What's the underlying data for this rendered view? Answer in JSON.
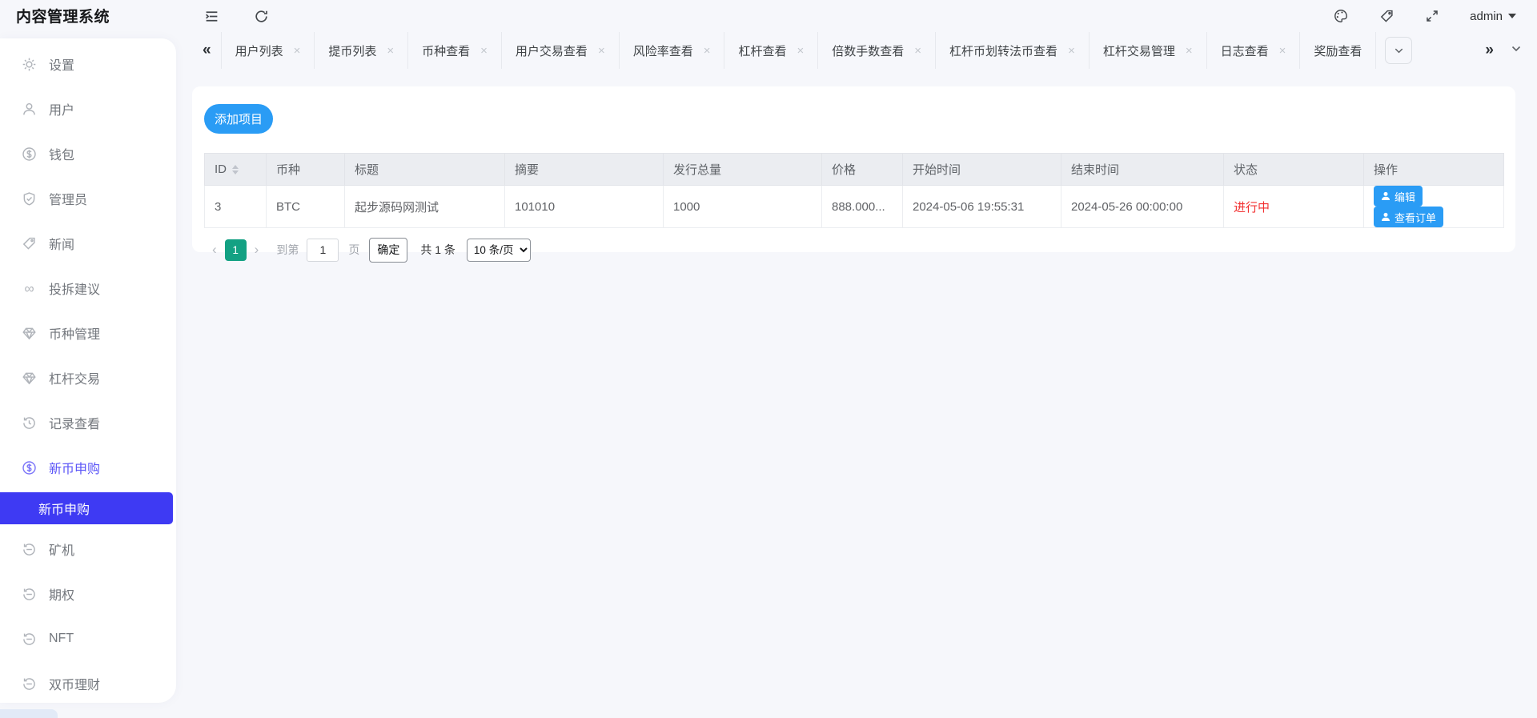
{
  "app": {
    "title": "内容管理系统"
  },
  "topbar": {
    "user": "admin"
  },
  "tabbar": {
    "tabs": [
      "用户列表",
      "提币列表",
      "币种查看",
      "用户交易查看",
      "风险率查看",
      "杠杆查看",
      "倍数手数查看",
      "杠杆币划转法币查看",
      "杠杆交易管理",
      "日志查看",
      "奖励查看"
    ]
  },
  "sidebar": {
    "items": [
      {
        "label": "设置",
        "icon": "gear"
      },
      {
        "label": "用户",
        "icon": "user"
      },
      {
        "label": "钱包",
        "icon": "dollar-circle"
      },
      {
        "label": "管理员",
        "icon": "shield-check"
      },
      {
        "label": "新闻",
        "icon": "tag"
      },
      {
        "label": "投拆建议",
        "icon": "infinity"
      },
      {
        "label": "币种管理",
        "icon": "gem"
      },
      {
        "label": "杠杆交易",
        "icon": "gem"
      },
      {
        "label": "记录查看",
        "icon": "history"
      },
      {
        "label": "新币申购",
        "icon": "dollar-circle"
      },
      {
        "label": "矿机",
        "icon": "history"
      },
      {
        "label": "期权",
        "icon": "history"
      },
      {
        "label": "NFT",
        "icon": "history"
      },
      {
        "label": "双币理财",
        "icon": "history"
      }
    ],
    "active_parent": "新币申购",
    "active_submenu": "新币申购"
  },
  "content": {
    "add_button": "添加项目",
    "table": {
      "columns": [
        "ID",
        "币种",
        "标题",
        "摘要",
        "发行总量",
        "价格",
        "开始时间",
        "结束时间",
        "状态",
        "操作"
      ],
      "row": {
        "id": "3",
        "coin": "BTC",
        "title": "起步源码网测试",
        "summary": "101010",
        "total": "1000",
        "price": "888.000...",
        "start": "2024-05-06 19:55:31",
        "end": "2024-05-26 00:00:00",
        "status": "进行中",
        "action_edit": "编辑",
        "action_orders": "查看订单"
      }
    },
    "pagination": {
      "prev": "‹",
      "page": "1",
      "next": "›",
      "goto_prefix": "到第",
      "goto_value": "1",
      "goto_suffix": "页",
      "confirm": "确定",
      "total": "共 1 条",
      "page_size": "10 条/页"
    }
  },
  "colors": {
    "accent_blue": "#2a9cf5",
    "active_menu_bg": "#3e3af3",
    "active_menu_text": "#5b55f7",
    "status_red": "#f23030",
    "pager_teal": "#13a183"
  }
}
